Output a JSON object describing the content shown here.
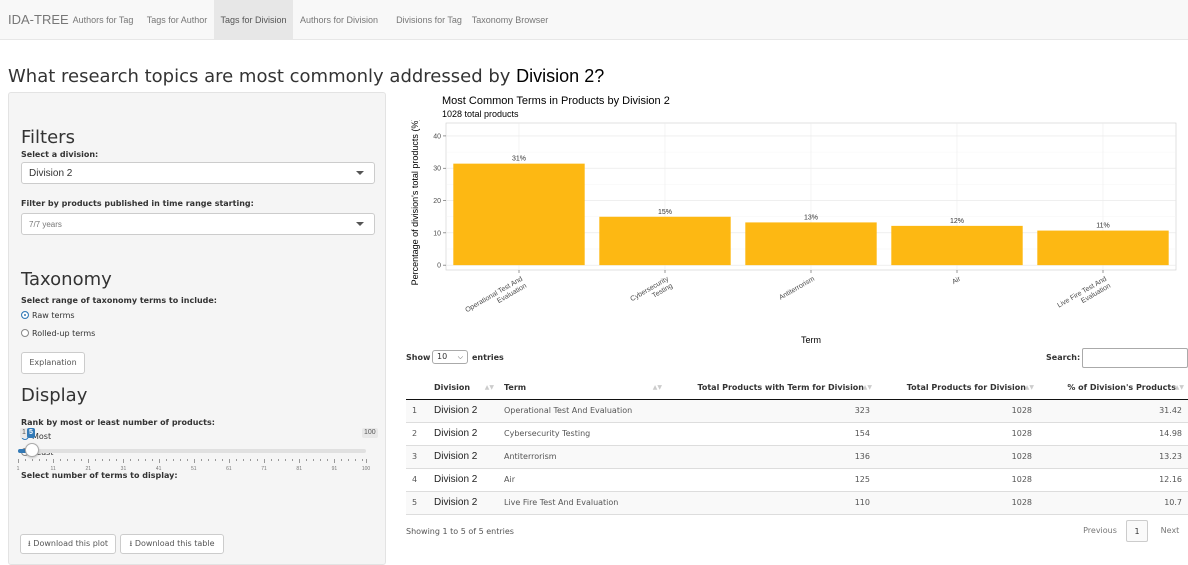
{
  "navbar": {
    "brand": "IDA-TREE",
    "tabs": [
      {
        "label": "Authors for Tag"
      },
      {
        "label": "Tags for Author"
      },
      {
        "label": "Tags for Division"
      },
      {
        "label": "Authors for Division"
      },
      {
        "label": "Divisions for Tag"
      },
      {
        "label": "Taxonomy Browser"
      }
    ],
    "active_tab": "Tags for Division"
  },
  "page": {
    "title_prefix": "What research topics are most commonly addressed by",
    "title_division": "Division 2?"
  },
  "sidebar": {
    "filters_title": "Filters",
    "division_label": "Select a division:",
    "division_value": "Division 2",
    "time_label": "Filter by products published in time range starting:",
    "time_value": "7/7 years",
    "taxonomy_title": "Taxonomy",
    "taxonomy_label": "Select range of taxonomy terms to include:",
    "taxonomy_options": [
      "Raw terms",
      "Rolled-up terms"
    ],
    "taxonomy_selected": "Raw terms",
    "explanation_button": "Explanation",
    "display_title": "Display",
    "rank_label": "Rank by most or least number of products:",
    "rank_options": [
      "Most",
      "Least"
    ],
    "rank_selected": "Most",
    "terms_label": "Select number of terms to display:",
    "slider": {
      "min_label": "1",
      "value": "5",
      "max_label": "100",
      "min": 1,
      "max": 100,
      "ticks": [
        "1",
        "11",
        "21",
        "31",
        "41",
        "51",
        "61",
        "71",
        "81",
        "91",
        "100"
      ]
    },
    "download_plot": "Download this plot",
    "download_table": "Download this table"
  },
  "chart_data": {
    "type": "bar",
    "title": "Most Common Terms in Products by Division 2",
    "subtitle": "1028 total products",
    "xlabel": "Term",
    "ylabel": "Percentage of division's total products (%)",
    "categories": [
      "Operational Test And Evaluation",
      "Cybersecurity Testing",
      "Antiterrorism",
      "Air",
      "Live Fire Test And Evaluation"
    ],
    "tick_labels": [
      [
        "Operational Test And",
        "Evaluation"
      ],
      [
        "Cybersecurity",
        "Testing"
      ],
      [
        "Antiterrorism"
      ],
      [
        "Air"
      ],
      [
        "Live Fire Test And",
        "Evaluation"
      ]
    ],
    "values": [
      31.42,
      14.98,
      13.23,
      12.16,
      10.7
    ],
    "data_labels": [
      "31%",
      "15%",
      "13%",
      "12%",
      "11%"
    ],
    "y_ticks": [
      "0",
      "10",
      "20",
      "30",
      "40"
    ],
    "ylim": [
      -1.5,
      44
    ],
    "grid": true,
    "bar_color": "#FDB813"
  },
  "table": {
    "show_label": "Show",
    "entries_value": "10",
    "entries_label": "entries",
    "search_label": "Search:",
    "columns": [
      "Division",
      "Term",
      "Total Products with Term for Division",
      "Total Products for Division",
      "% of Division's Products"
    ],
    "rows": [
      [
        "1",
        "Division 2",
        "Operational Test And Evaluation",
        "323",
        "1028",
        "31.42"
      ],
      [
        "2",
        "Division 2",
        "Cybersecurity Testing",
        "154",
        "1028",
        "14.98"
      ],
      [
        "3",
        "Division 2",
        "Antiterrorism",
        "136",
        "1028",
        "13.23"
      ],
      [
        "4",
        "Division 2",
        "Air",
        "125",
        "1028",
        "12.16"
      ],
      [
        "5",
        "Division 2",
        "Live Fire Test And Evaluation",
        "110",
        "1028",
        "10.7"
      ]
    ],
    "info": "Showing 1 to 5 of 5 entries",
    "prev_label": "Previous",
    "current_page": "1",
    "next_label": "Next"
  },
  "colors": {
    "accent": "#337ab7",
    "bar": "#FDB813"
  }
}
